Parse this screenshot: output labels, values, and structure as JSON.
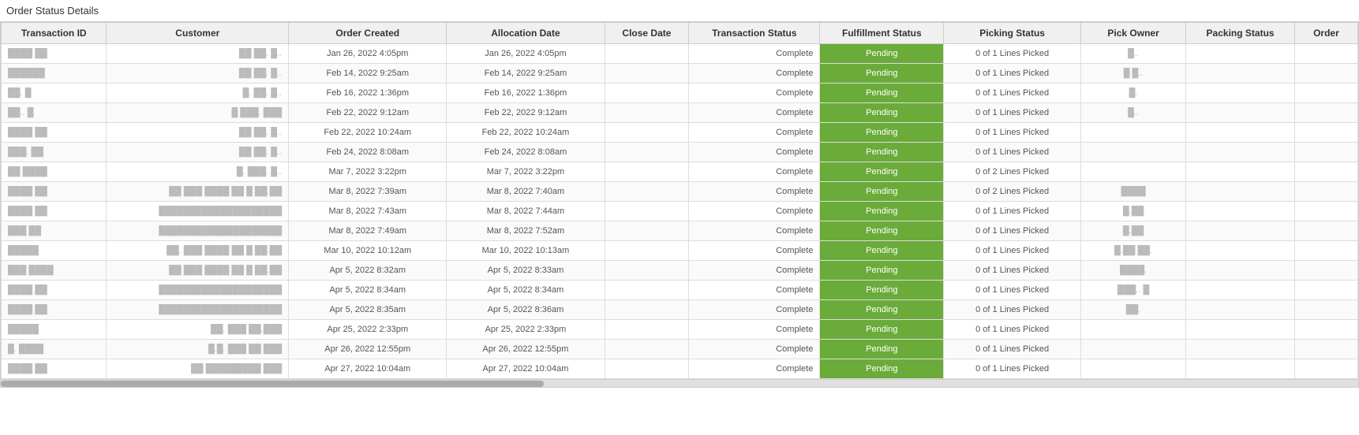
{
  "page": {
    "title": "Order Status Details"
  },
  "table": {
    "columns": [
      "Transaction ID",
      "Customer",
      "Order Created",
      "Allocation Date",
      "Close Date",
      "Transaction Status",
      "Fulfillment Status",
      "Picking Status",
      "Pick Owner",
      "Packing Status",
      "Order"
    ],
    "rows": [
      {
        "transaction_id": "████ ██",
        "customer": "██ ██. █..",
        "order_created": "Jan 26, 2022 4:05pm",
        "allocation_date": "Jan 26, 2022 4:05pm",
        "close_date": "",
        "transaction_status": "Complete",
        "fulfillment_status": "Pending",
        "picking_status": "0 of 1 Lines Picked",
        "pick_owner": "█..",
        "packing_status": "",
        "order": ""
      },
      {
        "transaction_id": "██████",
        "customer": "██ ██. █..",
        "order_created": "Feb 14, 2022 9:25am",
        "allocation_date": "Feb 14, 2022 9:25am",
        "close_date": "",
        "transaction_status": "Complete",
        "fulfillment_status": "Pending",
        "picking_status": "0 of 1 Lines Picked",
        "pick_owner": "█  █..",
        "packing_status": "",
        "order": ""
      },
      {
        "transaction_id": "██. █",
        "customer": "█.  ██. █..",
        "order_created": "Feb 16, 2022 1:36pm",
        "allocation_date": "Feb 16, 2022 1:36pm",
        "close_date": "",
        "transaction_status": "Complete",
        "fulfillment_status": "Pending",
        "picking_status": "0 of 1 Lines Picked",
        "pick_owner": "█.",
        "packing_status": "",
        "order": ""
      },
      {
        "transaction_id": "██.. █",
        "customer": "█  ███. ███",
        "order_created": "Feb 22, 2022 9:12am",
        "allocation_date": "Feb 22, 2022 9:12am",
        "close_date": "",
        "transaction_status": "Complete",
        "fulfillment_status": "Pending",
        "picking_status": "0 of 1 Lines Picked",
        "pick_owner": "█..",
        "packing_status": "",
        "order": ""
      },
      {
        "transaction_id": "████ ██",
        "customer": "██ ██. █..",
        "order_created": "Feb 22, 2022 10:24am",
        "allocation_date": "Feb 22, 2022 10:24am",
        "close_date": "",
        "transaction_status": "Complete",
        "fulfillment_status": "Pending",
        "picking_status": "0 of 1 Lines Picked",
        "pick_owner": "",
        "packing_status": "",
        "order": ""
      },
      {
        "transaction_id": "███. ██",
        "customer": "██ ██. █..",
        "order_created": "Feb 24, 2022 8:08am",
        "allocation_date": "Feb 24, 2022 8:08am",
        "close_date": "",
        "transaction_status": "Complete",
        "fulfillment_status": "Pending",
        "picking_status": "0 of 1 Lines Picked",
        "pick_owner": "",
        "packing_status": "",
        "order": ""
      },
      {
        "transaction_id": "██ ████",
        "customer": "█.  ███. █..",
        "order_created": "Mar 7, 2022 3:22pm",
        "allocation_date": "Mar 7, 2022 3:22pm",
        "close_date": "",
        "transaction_status": "Complete",
        "fulfillment_status": "Pending",
        "picking_status": "0 of 2 Lines Picked",
        "pick_owner": "",
        "packing_status": "",
        "order": ""
      },
      {
        "transaction_id": "████ ██",
        "customer": "██ ███ ████ ██ █ ██.██",
        "order_created": "Mar 8, 2022 7:39am",
        "allocation_date": "Mar 8, 2022 7:40am",
        "close_date": "",
        "transaction_status": "Complete",
        "fulfillment_status": "Pending",
        "picking_status": "0 of 2 Lines Picked",
        "pick_owner": "████",
        "packing_status": "",
        "order": ""
      },
      {
        "transaction_id": "████ ██",
        "customer": "████████████████████",
        "order_created": "Mar 8, 2022 7:43am",
        "allocation_date": "Mar 8, 2022 7:44am",
        "close_date": "",
        "transaction_status": "Complete",
        "fulfillment_status": "Pending",
        "picking_status": "0 of 1 Lines Picked",
        "pick_owner": "█.██",
        "packing_status": "",
        "order": ""
      },
      {
        "transaction_id": "███ ██",
        "customer": "████████████████████",
        "order_created": "Mar 8, 2022 7:49am",
        "allocation_date": "Mar 8, 2022 7:52am",
        "close_date": "",
        "transaction_status": "Complete",
        "fulfillment_status": "Pending",
        "picking_status": "0 of 1 Lines Picked",
        "pick_owner": "█.██",
        "packing_status": "",
        "order": ""
      },
      {
        "transaction_id": "█████",
        "customer": "██. ███ ████ ██ █ ██.██",
        "order_created": "Mar 10, 2022 10:12am",
        "allocation_date": "Mar 10, 2022 10:13am",
        "close_date": "",
        "transaction_status": "Complete",
        "fulfillment_status": "Pending",
        "picking_status": "0 of 1 Lines Picked",
        "pick_owner": "█.██  ██.",
        "packing_status": "",
        "order": ""
      },
      {
        "transaction_id": "███ ████",
        "customer": "██ ███ ████ ██ █ ██.██",
        "order_created": "Apr 5, 2022 8:32am",
        "allocation_date": "Apr 5, 2022 8:33am",
        "close_date": "",
        "transaction_status": "Complete",
        "fulfillment_status": "Pending",
        "picking_status": "0 of 1 Lines Picked",
        "pick_owner": "████.",
        "packing_status": "",
        "order": ""
      },
      {
        "transaction_id": "████ ██",
        "customer": "████████████████████",
        "order_created": "Apr 5, 2022 8:34am",
        "allocation_date": "Apr 5, 2022 8:34am",
        "close_date": "",
        "transaction_status": "Complete",
        "fulfillment_status": "Pending",
        "picking_status": "0 of 1 Lines Picked",
        "pick_owner": "███.. █",
        "packing_status": "",
        "order": ""
      },
      {
        "transaction_id": "████ ██",
        "customer": "████████████████████",
        "order_created": "Apr 5, 2022 8:35am",
        "allocation_date": "Apr 5, 2022 8:36am",
        "close_date": "",
        "transaction_status": "Complete",
        "fulfillment_status": "Pending",
        "picking_status": "0 of 1 Lines Picked",
        "pick_owner": "██.",
        "packing_status": "",
        "order": ""
      },
      {
        "transaction_id": "█████",
        "customer": "██. ███  ██.███",
        "order_created": "Apr 25, 2022 2:33pm",
        "allocation_date": "Apr 25, 2022 2:33pm",
        "close_date": "",
        "transaction_status": "Complete",
        "fulfillment_status": "Pending",
        "picking_status": "0 of 1 Lines Picked",
        "pick_owner": "",
        "packing_status": "",
        "order": ""
      },
      {
        "transaction_id": "█. ████",
        "customer": "█.█. ███  ██ ███",
        "order_created": "Apr 26, 2022 12:55pm",
        "allocation_date": "Apr 26, 2022 12:55pm",
        "close_date": "",
        "transaction_status": "Complete",
        "fulfillment_status": "Pending",
        "picking_status": "0 of 1 Lines Picked",
        "pick_owner": "",
        "packing_status": "",
        "order": ""
      },
      {
        "transaction_id": "████ ██",
        "customer": "██ █████████ ███",
        "order_created": "Apr 27, 2022 10:04am",
        "allocation_date": "Apr 27, 2022 10:04am",
        "close_date": "",
        "transaction_status": "Complete",
        "fulfillment_status": "Pending",
        "picking_status": "0 of 1 Lines Picked",
        "pick_owner": "",
        "packing_status": "",
        "order": ""
      }
    ]
  }
}
